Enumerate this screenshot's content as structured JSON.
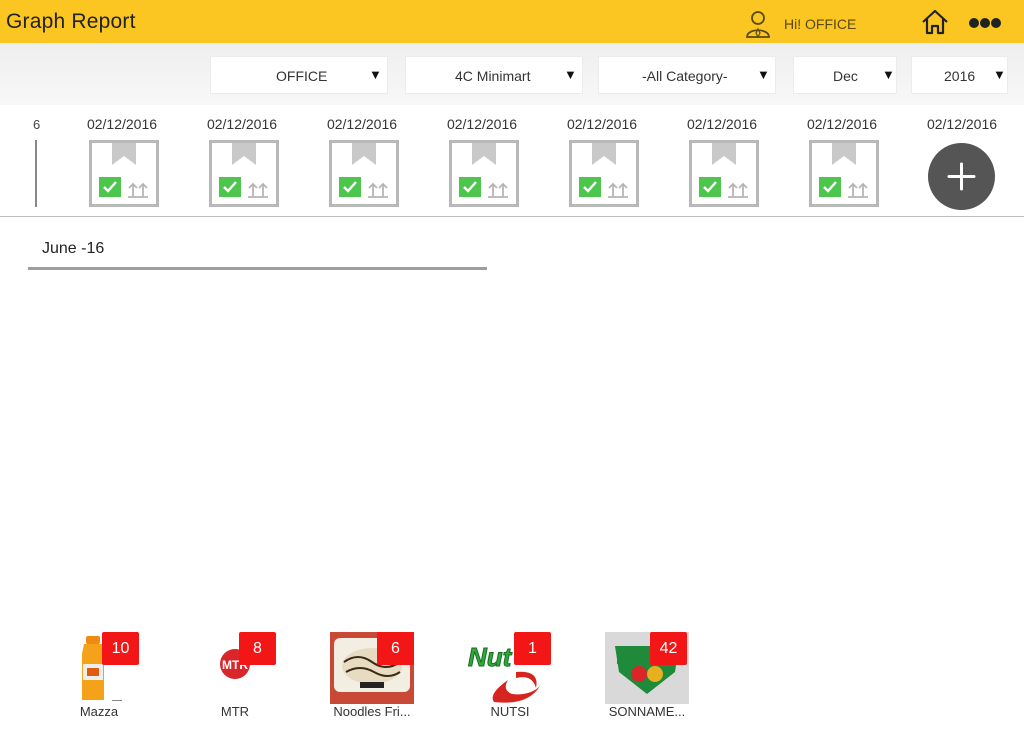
{
  "header": {
    "title": "Graph Report",
    "greeting": "Hi! OFFICE",
    "icons": [
      "user-icon",
      "home-icon",
      "more-dots-icon"
    ],
    "accent_color": "#fbc622"
  },
  "filters": [
    {
      "name": "office-filter",
      "value": "OFFICE"
    },
    {
      "name": "store-filter",
      "value": "4C Minimart"
    },
    {
      "name": "category-filter",
      "value": "-All Category-"
    },
    {
      "name": "month-filter",
      "value": "Dec"
    },
    {
      "name": "year-filter",
      "value": "2016"
    }
  ],
  "date_strip": {
    "partial_label": "6",
    "items": [
      {
        "date": "02/12/2016"
      },
      {
        "date": "02/12/2016"
      },
      {
        "date": "02/12/2016"
      },
      {
        "date": "02/12/2016"
      },
      {
        "date": "02/12/2016"
      },
      {
        "date": "02/12/2016"
      },
      {
        "date": "02/12/2016"
      }
    ],
    "add_item_date": "02/12/2016",
    "check_color": "#4cc64c"
  },
  "month_section": {
    "heading": "June -16"
  },
  "brands": [
    {
      "name": "Mazza",
      "count": "10"
    },
    {
      "name": "MTR",
      "count": "8"
    },
    {
      "name": "Noodles Fri...",
      "count": "6"
    },
    {
      "name": "NUTSI",
      "count": "1"
    },
    {
      "name": "SONNAME...",
      "count": "42"
    }
  ],
  "badge_color": "#f21616"
}
